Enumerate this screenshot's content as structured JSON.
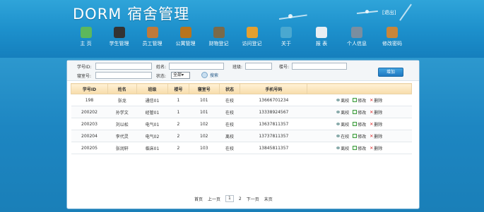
{
  "header": {
    "title": "DORM 宿舍管理",
    "logout": "[退出]"
  },
  "nav": [
    {
      "label": "主 页",
      "icon": "home-icon",
      "color": "#5cb85c"
    },
    {
      "label": "学生管理",
      "icon": "student-icon",
      "color": "#333333"
    },
    {
      "label": "员工管理",
      "icon": "staff-icon",
      "color": "#c07a3a"
    },
    {
      "label": "公寓管理",
      "icon": "apartment-icon",
      "color": "#b8741c"
    },
    {
      "label": "财物登记",
      "icon": "property-icon",
      "color": "#7a6a4a"
    },
    {
      "label": "访问登记",
      "icon": "visit-icon",
      "color": "#e3a030"
    },
    {
      "label": "关于",
      "icon": "about-icon",
      "color": "#4aa8d0"
    },
    {
      "label": "报 表",
      "icon": "report-icon",
      "color": "#e8eef3"
    },
    {
      "label": "个人信息",
      "icon": "profile-icon",
      "color": "#7a8ea0"
    },
    {
      "label": "修改密码",
      "icon": "password-icon",
      "color": "#c8863a"
    }
  ],
  "filters": {
    "student_id_label": "学号ID:",
    "name_label": "姓名:",
    "class_label": "班级:",
    "building_label": "楼号:",
    "room_label": "寝室号:",
    "status_label": "状态:",
    "status_value": "全部",
    "search_label": "搜索",
    "add_label": "增加"
  },
  "table": {
    "headers": [
      "学号ID",
      "姓名",
      "班级",
      "楼号",
      "寝室号",
      "状态",
      "手机号码",
      ""
    ],
    "rows": [
      {
        "cells": [
          "198",
          "张龙",
          "通信01",
          "1",
          "101",
          "在校",
          "13666701234"
        ],
        "toggle": "离校"
      },
      {
        "cells": [
          "200202",
          "孙学文",
          "经管01",
          "1",
          "101",
          "在校",
          "13338924567"
        ],
        "toggle": "离校"
      },
      {
        "cells": [
          "200203",
          "刘以松",
          "电气01",
          "2",
          "102",
          "在校",
          "13637811357"
        ],
        "toggle": "离校"
      },
      {
        "cells": [
          "200204",
          "李代灵",
          "电气02",
          "2",
          "102",
          "离校",
          "13737811357"
        ],
        "toggle": "在校"
      },
      {
        "cells": [
          "200205",
          "张润轩",
          "临床01",
          "2",
          "103",
          "在校",
          "13845811357"
        ],
        "toggle": "离校"
      }
    ],
    "edit_label": "修改",
    "delete_label": "删除"
  },
  "pager": {
    "first": "首页",
    "prev": "上一页",
    "pages": [
      "1",
      "2"
    ],
    "next": "下一页",
    "last": "末页"
  }
}
